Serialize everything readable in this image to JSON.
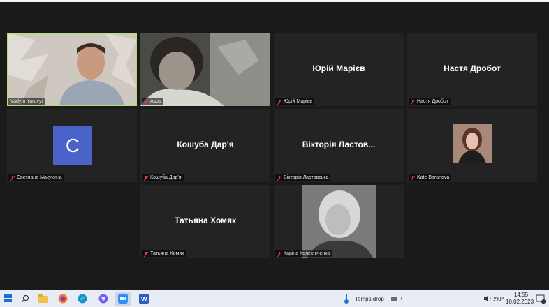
{
  "top_strip": {
    "text": "..."
  },
  "participants": [
    {
      "id": "vadym",
      "label": "Vadym Yarovyi",
      "display_name": "",
      "muted": false,
      "type": "video"
    },
    {
      "id": "asus",
      "label": "Asus",
      "display_name": "",
      "muted": true,
      "type": "video"
    },
    {
      "id": "yuriy",
      "label": "Юрій Марієв",
      "display_name": "Юрій Марієв",
      "muted": true,
      "type": "name"
    },
    {
      "id": "nastya",
      "label": "Настя Дробот",
      "display_name": "Настя Дробот",
      "muted": true,
      "type": "name"
    },
    {
      "id": "svetlana",
      "label": "Светлана Макухина",
      "display_name": "",
      "avatar_letter": "C",
      "muted": true,
      "type": "avatar"
    },
    {
      "id": "koshuba",
      "label": "Кошуба Дар'я",
      "display_name": "Кошуба Дар'я",
      "muted": true,
      "type": "name"
    },
    {
      "id": "viktoria",
      "label": "Вікторія Ластовська",
      "display_name": "Вікторія Ластов...",
      "muted": true,
      "type": "name"
    },
    {
      "id": "kate",
      "label": "Kate Baranova",
      "display_name": "",
      "muted": true,
      "type": "photo"
    },
    {
      "id": "tatyana",
      "label": "Татьяна Хомяк",
      "display_name": "Татьяна Хомяк",
      "muted": true,
      "type": "name"
    },
    {
      "id": "karina",
      "label": "Каріна Колесніченко",
      "display_name": "",
      "muted": true,
      "type": "photo"
    }
  ],
  "taskbar": {
    "weather": "Temps drop",
    "language": "УКР",
    "time": "14:55",
    "date": "10.02.2023",
    "notifications": "2",
    "apps": [
      "start-icon",
      "search-icon",
      "file-explorer-icon",
      "firefox-icon",
      "edge-icon",
      "viber-icon",
      "zoom-icon",
      "word-icon"
    ]
  },
  "colors": {
    "active_speaker": "#b5e06b",
    "muted_mic": "#e03c3c",
    "avatar_bg": "#4a63c8"
  }
}
